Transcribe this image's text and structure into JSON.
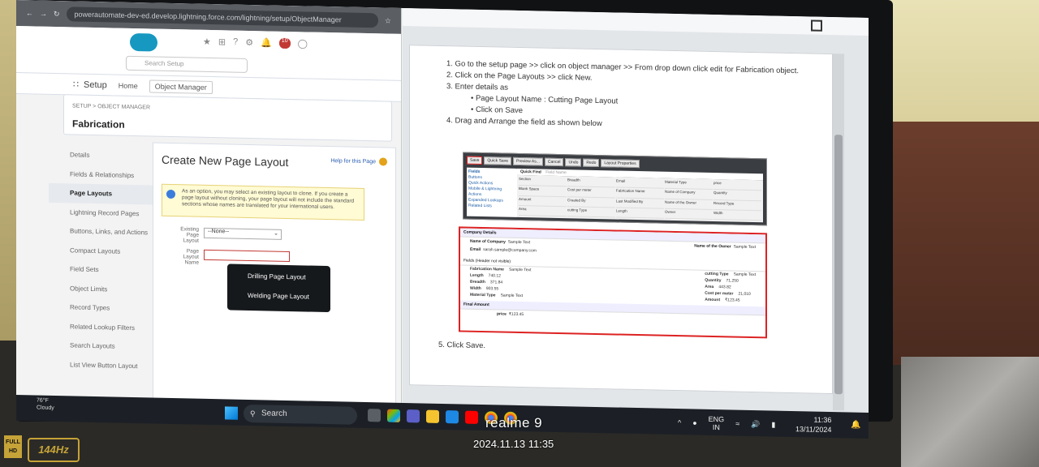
{
  "browser": {
    "url": "powerautomate-dev-ed.develop.lightning.force.com/lightning/setup/ObjectManager"
  },
  "salesforce": {
    "search_placeholder": "Search Setup",
    "notification_count": "10",
    "app_name": "Setup",
    "nav_home": "Home",
    "nav_object_manager": "Object Manager",
    "breadcrumb": "SETUP > OBJECT MANAGER",
    "object_name": "Fabrication",
    "left_nav": [
      "Details",
      "Fields & Relationships",
      "Page Layouts",
      "Lightning Record Pages",
      "Buttons, Links, and Actions",
      "Compact Layouts",
      "Field Sets",
      "Object Limits",
      "Record Types",
      "Related Lookup Filters",
      "Search Layouts",
      "List View Button Layout"
    ],
    "active_nav_index": 2,
    "page_title": "Create New Page Layout",
    "help_link": "Help for this Page",
    "info_text": "As an option, you may select an existing layout to clone. If you create a page layout without cloning, your page layout will not include the standard sections whose names are translated for your international users.",
    "existing_layout_label": "Existing Page Layout",
    "existing_layout_value": "--None--",
    "layout_name_label": "Page Layout Name",
    "layout_name_value": "",
    "tooltip_items": [
      "Drilling Page Layout",
      "Welding Page Layout"
    ]
  },
  "document": {
    "steps": [
      "1. Go to the setup page >> click on object manager >> From drop down click edit for  Fabrication object.",
      "2. Click on the Page Layouts >> click New.",
      "3. Enter details as"
    ],
    "sub_steps": [
      "Page Layout Name : Cutting Page Layout",
      "Click on Save"
    ],
    "step4": "4. Drag and Arrange the field as shown below",
    "step5": "5. Click Save."
  },
  "embedded_toolbar": [
    "Save",
    "Quick Save",
    "Preview As...",
    "Cancel",
    "Undo",
    "Redo",
    "Layout Properties"
  ],
  "embedded_palette": [
    "Fields",
    "Buttons",
    "Quick Actions",
    "Mobile & Lightning Actions",
    "Expanded Lookups",
    "Related Lists"
  ],
  "embedded_quickfind": "Quick Find",
  "embedded_quickfind_placeholder": "Field Name",
  "embedded_fields": [
    "Section",
    "Breadth",
    "Email",
    "Material Type",
    "price",
    "Blank Space",
    "Cost per meter",
    "Fabrication Name",
    "Name of Company",
    "Quantity",
    "Amount",
    "Created By",
    "Last Modified By",
    "Name of the Owner",
    "Record Type",
    "Area",
    "cutting Type",
    "Length",
    "Owner",
    "Width"
  ],
  "embedded_layout": {
    "section1": "Company Details",
    "name_of_company_label": "Name of Company",
    "name_of_company": "Sample Text",
    "email_label": "Email",
    "email": "sarah.sample@company.com",
    "owner_label": "Name of the Owner",
    "owner": "Sample Text",
    "section2": "Fields (Header not visible)",
    "left_fields": [
      [
        "Fabrication Name",
        "Sample Text"
      ],
      [
        "Length",
        "740.12"
      ],
      [
        "Breadth",
        "371.84"
      ],
      [
        "Width",
        "903.55"
      ],
      [
        "Material Type",
        "Sample Text"
      ]
    ],
    "right_fields": [
      [
        "cutting Type",
        "Sample Text"
      ],
      [
        "Quantity",
        "71,250"
      ],
      [
        "Area",
        "443.82"
      ],
      [
        "Cost per meter",
        "21,010"
      ],
      [
        "Amount",
        "₹123.45"
      ]
    ],
    "section3": "Final Amount",
    "price_label": "price",
    "price": "₹123.45"
  },
  "taskbar": {
    "weather_temp": "76°F",
    "weather_desc": "Cloudy",
    "search": "Search",
    "lang1": "ENG",
    "lang2": "IN",
    "time": "11:36",
    "date": "13/11/2024"
  },
  "watermark": {
    "phone": "realme 9",
    "datetime": "2024.11.13 11:35",
    "fhd": "FULL HD",
    "hz": "144Hz"
  }
}
